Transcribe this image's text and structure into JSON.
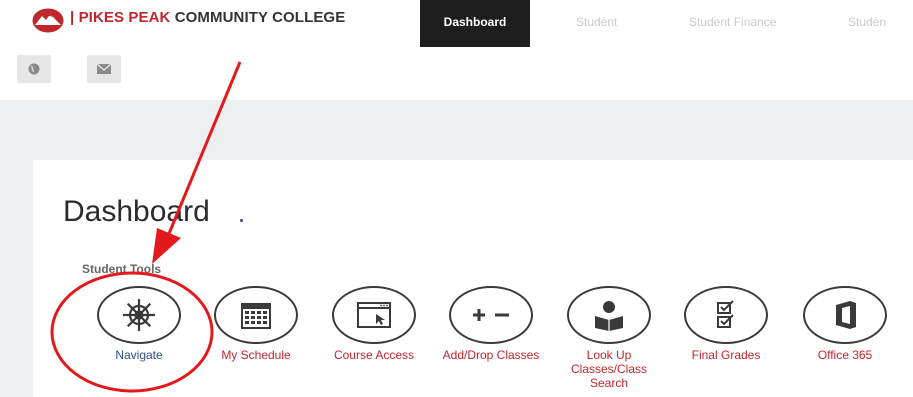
{
  "header": {
    "brand_bar": "|",
    "brand_pikes": "PIKES PEAK",
    "brand_rest": "COMMUNITY COLLEGE",
    "nav": [
      "Dashboard",
      "Student",
      "Student Finance",
      "Studen"
    ]
  },
  "toolbar": {
    "icons": [
      "globe-icon",
      "mail-icon"
    ]
  },
  "main": {
    "title": "Dashboard",
    "section": "Student Tools",
    "tools": [
      {
        "label": "Navigate",
        "icon": "ship-wheel-icon"
      },
      {
        "label": "My Schedule",
        "icon": "calendar-icon"
      },
      {
        "label": "Course Access",
        "icon": "browser-cursor-icon"
      },
      {
        "label": "Add/Drop Classes",
        "icon": "plus-minus-icon"
      },
      {
        "label": "Look Up Classes/Class Search",
        "icon": "book-reader-icon"
      },
      {
        "label": "Final Grades",
        "icon": "checklist-icon"
      },
      {
        "label": "Office 365",
        "icon": "office-icon"
      }
    ]
  },
  "colors": {
    "brand_red": "#c0272d",
    "nav_active_bg": "#1e1e1e",
    "annotation_red": "#e3191c",
    "link_blue": "#2f4f86"
  }
}
